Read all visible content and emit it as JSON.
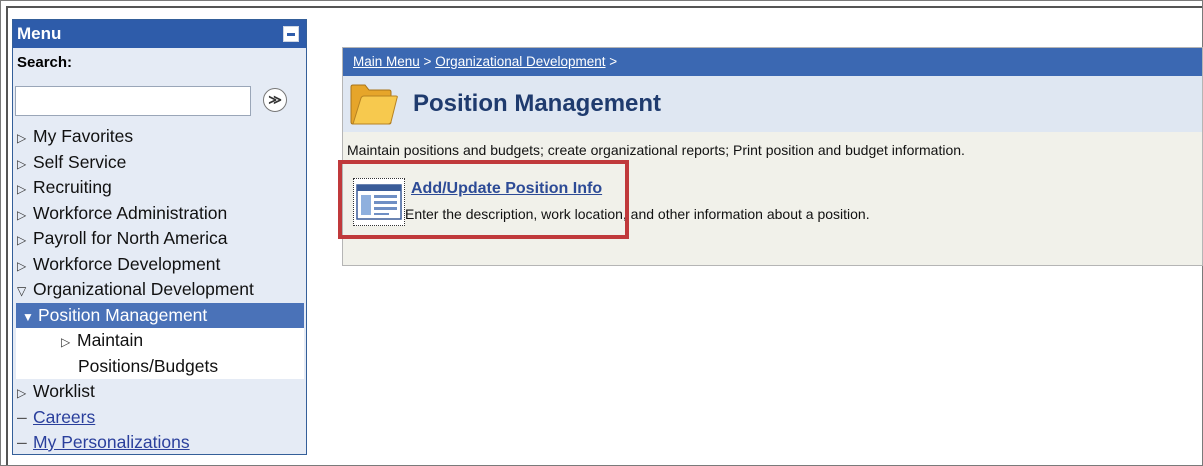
{
  "menu": {
    "title": "Menu",
    "search_label": "Search:",
    "search_value": "",
    "search_go_glyph": "≫",
    "items": [
      {
        "label": "My Favorites",
        "state": "collapsed"
      },
      {
        "label": "Self Service",
        "state": "collapsed"
      },
      {
        "label": "Recruiting",
        "state": "collapsed"
      },
      {
        "label": "Workforce Administration",
        "state": "collapsed"
      },
      {
        "label": "Payroll for North America",
        "state": "collapsed"
      },
      {
        "label": "Workforce Development",
        "state": "collapsed"
      },
      {
        "label": "Organizational Development",
        "state": "expanded"
      }
    ],
    "sub_selected": "Position Management",
    "sub_child_line1": "Maintain",
    "sub_child_line2": "Positions/Budgets",
    "after_items": [
      {
        "label": "Worklist",
        "state": "collapsed"
      }
    ],
    "links": [
      "Careers",
      "My Personalizations"
    ]
  },
  "breadcrumb": {
    "main_menu": "Main Menu",
    "sep1": " > ",
    "org_dev": "Organizational Development",
    "sep2": " >"
  },
  "page": {
    "title": "Position Management",
    "description": "Maintain positions and budgets; create organizational reports; Print position and budget information.",
    "component_link": "Add/Update Position Info",
    "component_description": "Enter the description, work location, and other information about a position."
  },
  "colors": {
    "menu_header": "#2e5caa",
    "breadcrumb_bg": "#3b68b2",
    "selected_item": "#4a72b8",
    "highlight": "#c0393b"
  }
}
